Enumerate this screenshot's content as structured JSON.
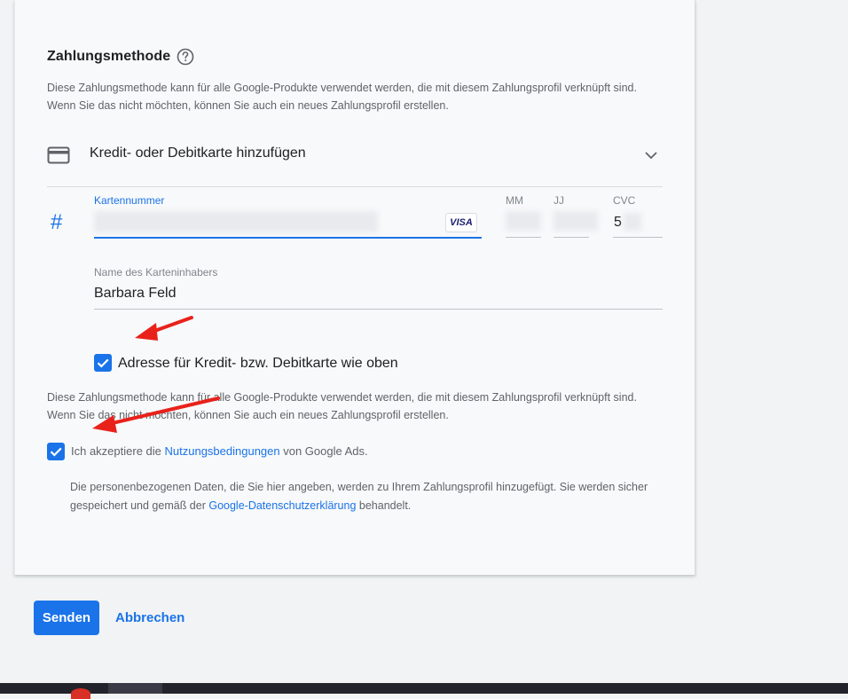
{
  "payment": {
    "title": "Zahlungsmethode",
    "description": "Diese Zahlungsmethode kann für alle Google-Produkte verwendet werden, die mit diesem Zahlungsprofil verknüpft sind. Wenn Sie das nicht möchten, können Sie auch ein neues Zahlungsprofil erstellen.",
    "method_label": "Kredit- oder Debitkarte hinzufügen"
  },
  "card_form": {
    "number_label": "Kartennummer",
    "number_value": "",
    "brand": "VISA",
    "mm_label": "MM",
    "jj_label": "JJ",
    "cvc_label": "CVC",
    "cvc_value": "5",
    "holder_label": "Name des Karteninhabers",
    "holder_value": "Barbara Feld"
  },
  "address_checkbox": {
    "label": "Adresse für Kredit- bzw. Debitkarte wie oben",
    "checked": true
  },
  "terms": {
    "before": "Ich akzeptiere die ",
    "link": "Nutzungsbedingungen",
    "after": " von Google Ads.",
    "checked": true
  },
  "privacy": {
    "before": "Die personenbezogenen Daten, die Sie hier angeben, werden zu Ihrem Zahlungsprofil hinzugefügt. Sie werden sicher gespeichert und gemäß der ",
    "link": "Google-Datenschutzerklärung",
    "after": " behandelt."
  },
  "actions": {
    "submit": "Senden",
    "cancel": "Abbrechen"
  },
  "colors": {
    "accent": "#1a73e8",
    "annotation": "#e8221b"
  },
  "icons": [
    "help-icon",
    "credit-card-icon",
    "chevron-down-icon",
    "hash-icon",
    "visa-logo",
    "checkmark-icon"
  ]
}
